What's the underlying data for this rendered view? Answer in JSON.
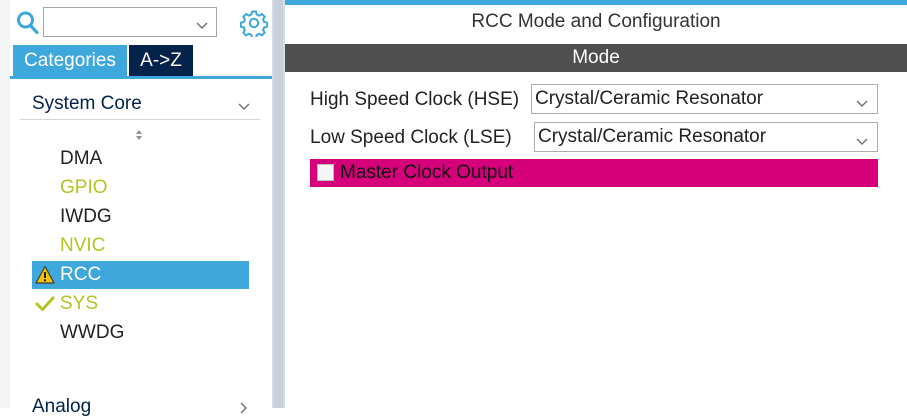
{
  "colors": {
    "accent": "#3ea8dc",
    "tab_dark": "#03234b",
    "mode_bar": "#4f4f4f",
    "highlight_pink": "#d6007a",
    "configured_green": "#b5c324",
    "warning_yellow": "#f5c400"
  },
  "search": {
    "value": "",
    "icon": "search-icon",
    "settings_icon": "gear-icon"
  },
  "tabs": [
    {
      "label": "Categories",
      "active": true
    },
    {
      "label": "A->Z",
      "active": false
    }
  ],
  "category": {
    "label": "System Core",
    "expanded": true
  },
  "items": [
    {
      "label": "DMA",
      "status": "none"
    },
    {
      "label": "GPIO",
      "status": "configured"
    },
    {
      "label": "IWDG",
      "status": "none"
    },
    {
      "label": "NVIC",
      "status": "configured"
    },
    {
      "label": "RCC",
      "status": "warning",
      "selected": true
    },
    {
      "label": "SYS",
      "status": "ok"
    },
    {
      "label": "WWDG",
      "status": "none"
    }
  ],
  "next_category": {
    "label": "Analog"
  },
  "panel": {
    "title": "RCC Mode and Configuration",
    "section": "Mode",
    "hse": {
      "label": "High Speed Clock (HSE)",
      "value": "Crystal/Ceramic Resonator"
    },
    "lse": {
      "label": "Low Speed Clock (LSE)",
      "value": "Crystal/Ceramic Resonator"
    },
    "mco": {
      "label": "Master Clock Output",
      "checked": false
    }
  }
}
